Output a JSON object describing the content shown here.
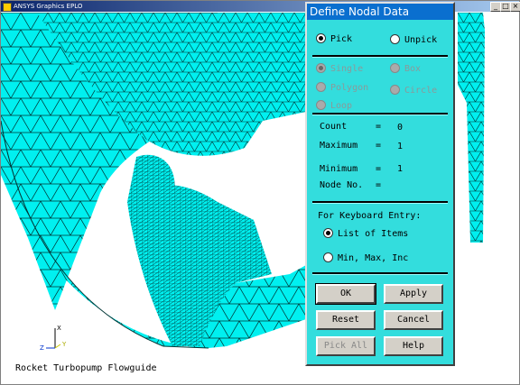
{
  "window": {
    "title": "ANSYS Graphics   EPLO",
    "min_glyph": "_",
    "max_glyph": "□",
    "close_glyph": "×"
  },
  "canvas": {
    "caption": "Rocket Turbopump Flowguide",
    "mesh_color": "#00f0f0",
    "background_color": "#ffffff",
    "triad": {
      "x": "X",
      "y": "Y",
      "z": "Z"
    }
  },
  "dialog": {
    "title": "Define Nodal Data",
    "pick_mode": {
      "pick": "Pick",
      "unpick": "Unpick",
      "selected": "pick"
    },
    "pick_type": {
      "single": "Single",
      "box": "Box",
      "polygon": "Polygon",
      "circle": "Circle",
      "loop": "Loop",
      "selected": "single",
      "enabled": false
    },
    "stats": {
      "count_label": "Count",
      "count_value": "0",
      "maximum_label": "Maximum",
      "maximum_value": "1",
      "minimum_label": "Minimum",
      "minimum_value": "1",
      "node_label": "Node No.",
      "node_value": "",
      "eq": "="
    },
    "keyboard": {
      "heading": "For Keyboard Entry:",
      "list_of_items": "List of Items",
      "min_max_inc": "Min, Max, Inc",
      "selected": "list"
    },
    "buttons": {
      "ok": "OK",
      "apply": "Apply",
      "reset": "Reset",
      "cancel": "Cancel",
      "pick_all": "Pick All",
      "help": "Help"
    },
    "colors": {
      "background": "#33dddd",
      "title_bar": "#0a6fcf"
    }
  }
}
